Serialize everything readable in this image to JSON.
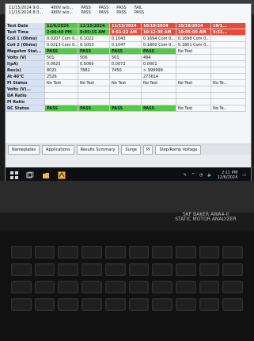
{
  "header_lines": [
    [
      "11/15/2024 9:0...",
      "480V w/o...",
      "PASS",
      "PASS",
      "PASS",
      "FAIL"
    ],
    [
      "11/15/2024 8:3...",
      "480V w/o...",
      "PASS",
      "PASS",
      "PASS",
      "PASS"
    ]
  ],
  "grid": {
    "rows": [
      {
        "label": "Test Date",
        "cells": [
          "12/6/2024",
          "11/15/2024",
          "11/15/2024",
          "10/18/2024",
          "10/18/2024",
          "10/1..."
        ],
        "states": [
          "pass",
          "pass",
          "fail",
          "fail",
          "fail",
          "fail"
        ]
      },
      {
        "label": "Test Time",
        "cells": [
          "2:06:40 PM",
          "8:05:15 AM",
          "8:51:22 AM",
          "10:12:38 AM",
          "10:05:00 AM",
          "9:51..."
        ],
        "states": [
          "pass",
          "pass",
          "fail",
          "fail",
          "fail",
          "fail"
        ]
      },
      {
        "label": "Coil 1 (Ohms)",
        "cells": [
          "0.0207 Com 0...",
          "0.1022",
          "0.1043",
          "0.1694 Com 0...",
          "0.1698 Com 0...",
          ""
        ],
        "states": [
          "",
          "",
          "",
          "",
          "",
          ""
        ]
      },
      {
        "label": "Coil 2 (Ohms)",
        "cells": [
          "0.0213 Com 0...",
          "0.1053",
          "0.1047",
          "0.1800 Com 0...",
          "0.1801 Com 0...",
          ""
        ],
        "states": [
          "",
          "",
          "",
          "",
          "",
          ""
        ]
      },
      {
        "label": "Megohm Stat...",
        "cells": [
          "PASS",
          "PASS",
          "PASS",
          "PASS",
          "No Test",
          ""
        ],
        "states": [
          "pass",
          "pass",
          "pass",
          "pass",
          "",
          ""
        ]
      },
      {
        "label": "Volts (V)",
        "cells": [
          "501",
          "506",
          "501",
          "494",
          "",
          ""
        ],
        "states": [
          "",
          "",
          "",
          "",
          "",
          ""
        ]
      },
      {
        "label": "I(pA)",
        "cells": [
          "0.0625",
          "0.0060",
          "0.0072",
          "0.0001",
          "",
          ""
        ],
        "states": [
          "",
          "",
          "",
          "",
          "",
          ""
        ]
      },
      {
        "label": "Res(s)",
        "cells": [
          "8021",
          "7882",
          "7450",
          "> 999999",
          "",
          ""
        ],
        "states": [
          "",
          "",
          "",
          "",
          "",
          ""
        ]
      },
      {
        "label": "At 40°C",
        "cells": [
          "2526",
          "",
          "",
          "275614",
          "",
          ""
        ],
        "states": [
          "",
          "",
          "",
          "",
          "",
          ""
        ]
      },
      {
        "label": "PI Status",
        "cells": [
          "No Test",
          "No Test",
          "No Test",
          "No Test",
          "No Test",
          "No Te..."
        ],
        "states": [
          "",
          "",
          "",
          "",
          "",
          ""
        ]
      },
      {
        "label": "Volts (V)...",
        "cells": [
          "",
          "",
          "",
          "",
          "",
          ""
        ],
        "states": [
          "",
          "",
          "",
          "",
          "",
          ""
        ]
      },
      {
        "label": "DA Ratio",
        "cells": [
          "",
          "",
          "",
          "",
          "",
          ""
        ],
        "states": [
          "",
          "",
          "",
          "",
          "",
          ""
        ]
      },
      {
        "label": "PI Ratio",
        "cells": [
          "",
          "",
          "",
          "",
          "",
          ""
        ],
        "states": [
          "",
          "",
          "",
          "",
          "",
          ""
        ]
      },
      {
        "label": "DC Status",
        "cells": [
          "PASS",
          "PASS",
          "PASS",
          "PASS",
          "No Test",
          "No Te..."
        ],
        "states": [
          "pass",
          "pass",
          "pass",
          "pass",
          "",
          ""
        ]
      }
    ]
  },
  "tabs": [
    "Nameplates",
    "Applications",
    "Results Summary",
    "Surge",
    "PI",
    "Step/Ramp Voltage"
  ],
  "taskbar": {
    "time": "2:11 PM",
    "date": "12/6/2024"
  },
  "brand": {
    "line1": "SKF BAKER AWA4-II",
    "line2": "STATIC MOTOR ANALYZER"
  },
  "colors": {
    "pass": "#55c84a",
    "fail": "#e74b3a",
    "selected": "#2a6ec5"
  }
}
